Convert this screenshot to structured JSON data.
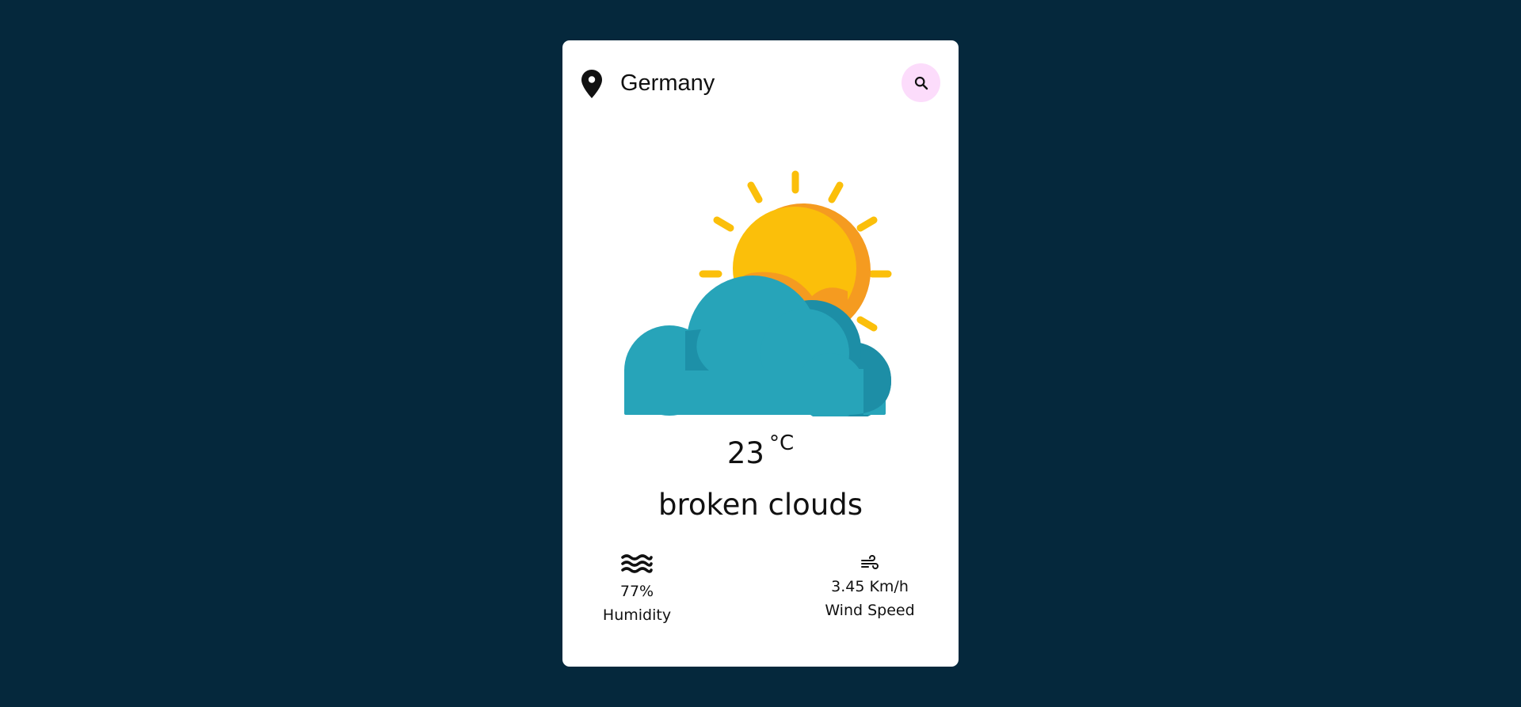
{
  "location": {
    "name": "Germany",
    "icon": "map-pin-icon"
  },
  "search": {
    "icon": "search-icon",
    "button_color": "#fcdcfb"
  },
  "weather": {
    "icon": "sun-behind-cloud-icon",
    "temperature": "23",
    "unit": "°C",
    "description": "broken clouds"
  },
  "stats": {
    "humidity": {
      "icon": "water-waves-icon",
      "value": "77%",
      "label": "Humidity"
    },
    "wind": {
      "icon": "wind-icon",
      "value": "3.45 Km/h",
      "label": "Wind Speed"
    }
  },
  "colors": {
    "background": "#05283c",
    "card": "#ffffff",
    "sun": "#fbbf0a",
    "sun_shade": "#f59b20",
    "cloud": "#27a4b9",
    "cloud_shade": "#1d8ea6"
  }
}
